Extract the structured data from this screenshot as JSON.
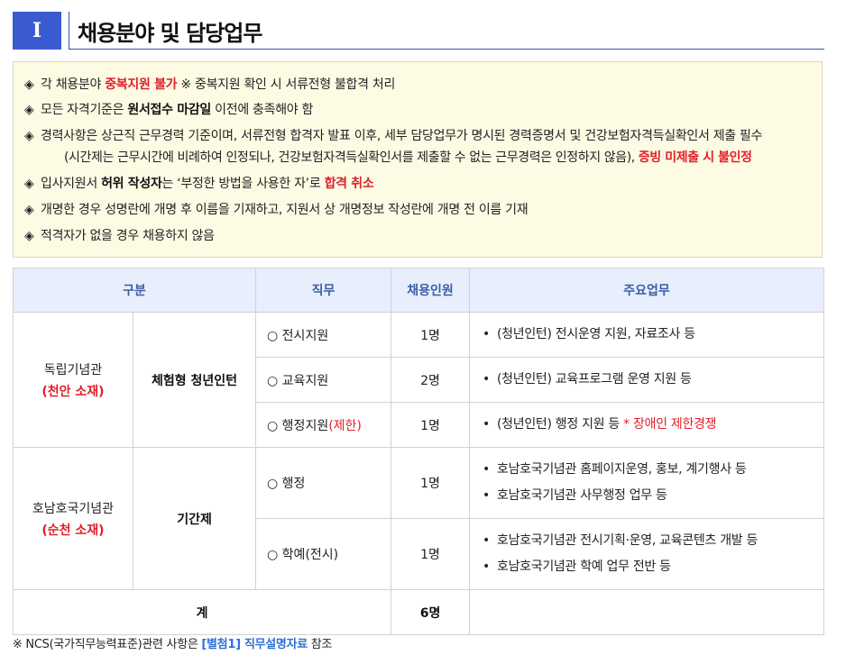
{
  "section": {
    "number": "I",
    "title": "채용분야 및 담당업무"
  },
  "notices": [
    {
      "bullet": "◈",
      "segments": [
        {
          "text": "각 채용분야 ",
          "style": "normal"
        },
        {
          "text": "중복지원 불가",
          "style": "red"
        },
        {
          "text": " ※ 중복지원 확인 시 서류전형 불합격 처리",
          "style": "normal"
        }
      ]
    },
    {
      "bullet": "◈",
      "segments": [
        {
          "text": "모든 자격기준은 ",
          "style": "normal"
        },
        {
          "text": "원서접수 마감일",
          "style": "bold"
        },
        {
          "text": " 이전에 충족해야 함",
          "style": "normal"
        }
      ]
    },
    {
      "bullet": "◈",
      "segments": [
        {
          "text": "경력사항은 상근직 근무경력 기준이며, 서류전형 합격자 발표 이후, 세부 담당업무가 명시된 경력증명서 및 건강보험자격득실확인서 제출 필수",
          "style": "normal"
        }
      ],
      "continuation": [
        {
          "text": "(시간제는 근무시간에 비례하여 인정되나, 건강보험자격득실확인서를 제출할 수 없는 근무경력은 인정하지 않음), ",
          "style": "normal"
        },
        {
          "text": "증빙 미제출 시 불인정",
          "style": "red"
        }
      ]
    },
    {
      "bullet": "◈",
      "segments": [
        {
          "text": "입사지원서 ",
          "style": "normal"
        },
        {
          "text": "허위 작성자",
          "style": "bold"
        },
        {
          "text": "는 ‘부정한 방법을 사용한 자’로 ",
          "style": "normal"
        },
        {
          "text": "합격 취소",
          "style": "red"
        }
      ]
    },
    {
      "bullet": "◈",
      "segments": [
        {
          "text": "개명한 경우 성명란에 개명 후 이름을 기재하고, 지원서 상 개명정보 작성란에 개명 전 이름 기재",
          "style": "normal"
        }
      ]
    },
    {
      "bullet": "◈",
      "segments": [
        {
          "text": "적격자가 없을 경우 채용하지 않음",
          "style": "normal"
        }
      ]
    }
  ],
  "table": {
    "headers": [
      "구분",
      "직무",
      "채용인원",
      "주요업무"
    ],
    "groups": [
      {
        "org": "독립기념관",
        "location": "(천안 소재)",
        "type": "체험형 청년인턴",
        "rows": [
          {
            "job": "○ 전시지원",
            "job_note": "",
            "count": "1명",
            "duties": [
              {
                "text": "(청년인턴) 전시운영 지원, 자료조사 등",
                "note": ""
              }
            ]
          },
          {
            "job": "○ 교육지원",
            "job_note": "",
            "count": "2명",
            "duties": [
              {
                "text": "(청년인턴) 교육프로그램 운영 지원 등",
                "note": ""
              }
            ]
          },
          {
            "job": "○ 행정지원",
            "job_note": "(제한)",
            "count": "1명",
            "duties": [
              {
                "text": "(청년인턴) 행정 지원 등 ",
                "note": "* 장애인 제한경쟁"
              }
            ]
          }
        ]
      },
      {
        "org": "호남호국기념관",
        "location": "(순천 소재)",
        "type": "기간제",
        "rows": [
          {
            "job": "○ 행정",
            "job_note": "",
            "count": "1명",
            "duties": [
              {
                "text": "호남호국기념관 홈페이지운영, 홍보, 계기행사 등",
                "note": ""
              },
              {
                "text": "호남호국기념관 사무행정 업무 등",
                "note": ""
              }
            ]
          },
          {
            "job": "○ 학예(전시)",
            "job_note": "",
            "count": "1명",
            "duties": [
              {
                "text": "호남호국기념관 전시기획·운영, 교육콘텐츠 개발 등",
                "note": ""
              },
              {
                "text": "호남호국기념관 학예 업무 전반 등",
                "note": ""
              }
            ]
          }
        ]
      }
    ],
    "total": {
      "label": "계",
      "count": "6명"
    },
    "duty_bullet": "•"
  },
  "footnote": {
    "prefix": "※  NCS(국가직무능력표준)관련 사항은 ",
    "link": "[별첨1] 직무설명자료",
    "suffix": " 참조"
  },
  "colors": {
    "accent": "#3a5bd0",
    "red": "#e0202a",
    "header_bg": "#e8eefb",
    "notice_bg": "#fdfbe4"
  }
}
